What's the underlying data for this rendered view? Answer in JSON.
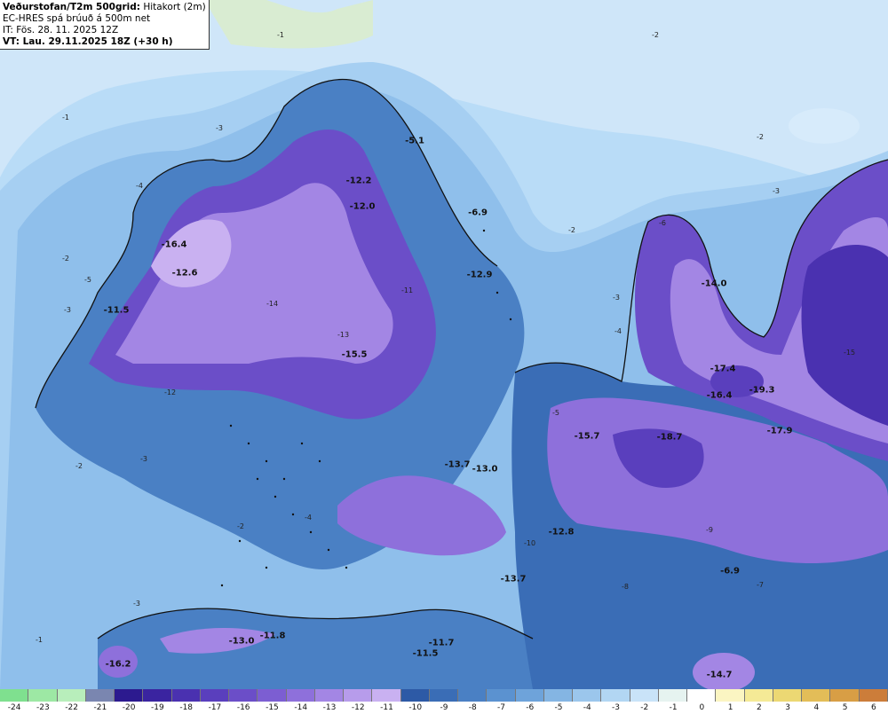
{
  "header": {
    "title_bold": "Veðurstofan/T2m 500grid:",
    "title_rest": " Hitakort (2m)",
    "line2": "EC-HRES spá brúuð á 500m net",
    "line3": "IT: Fös. 28. 11. 2025 12Z",
    "line4": "VT: Lau. 29.11.2025 18Z (+30 h)"
  },
  "map_labels": [
    {
      "text": "-12.2"
    },
    {
      "text": "-12.0"
    },
    {
      "text": "-16.4"
    },
    {
      "text": "-12.6"
    },
    {
      "text": "-11.5"
    },
    {
      "text": "-15.5"
    },
    {
      "text": "-12.9"
    },
    {
      "text": "-14.0"
    },
    {
      "text": "-17.4"
    },
    {
      "text": "-16.4"
    },
    {
      "text": "-19.3"
    },
    {
      "text": "-17.9"
    },
    {
      "text": "-15.7"
    },
    {
      "text": "-18.7"
    },
    {
      "text": "-13.7"
    },
    {
      "text": "-13.0"
    },
    {
      "text": "-12.8"
    },
    {
      "text": "-13.7"
    },
    {
      "text": "-6.9"
    },
    {
      "text": "-13.0"
    },
    {
      "text": "-11.8"
    },
    {
      "text": "-11.7"
    },
    {
      "text": "-11.5"
    },
    {
      "text": "-16.2"
    },
    {
      "text": "-14.7"
    },
    {
      "text": "-5.1"
    },
    {
      "text": "-6.9"
    }
  ],
  "contour_labels": [
    "-1",
    "-2",
    "-3",
    "-4",
    "-5",
    "-6",
    "-7",
    "-8",
    "-9",
    "-10",
    "-11",
    "-12",
    "-13",
    "-14",
    "-15"
  ],
  "colorbar": {
    "ticks": [
      "-24",
      "-23",
      "-22",
      "-21",
      "-20",
      "-19",
      "-18",
      "-17",
      "-16",
      "-15",
      "-14",
      "-13",
      "-12",
      "-11",
      "-10",
      "-9",
      "-8",
      "-7",
      "-6",
      "-5",
      "-4",
      "-3",
      "-2",
      "-1",
      "0",
      "1",
      "2",
      "3",
      "4",
      "5",
      "6"
    ],
    "colors": [
      "#7fe08f",
      "#9de8a4",
      "#b8eebb",
      "#7a86b0",
      "#2c1a8f",
      "#3a24a0",
      "#4a31b0",
      "#5a3fbd",
      "#6b4ec8",
      "#7c5ed2",
      "#8e70db",
      "#a386e4",
      "#b79ceb",
      "#c9b1f1",
      "#2d5aa6",
      "#3a6db6",
      "#4a80c4",
      "#5b92d0",
      "#6ea3da",
      "#84b5e3",
      "#9bc6ec",
      "#b2d6f3",
      "#c9e3f8",
      "#e6f3f0",
      "#ffffff",
      "#fbf5c2",
      "#f5ea96",
      "#ecd873",
      "#e3bd58",
      "#d89e45",
      "#cc7d3a"
    ]
  },
  "colors": {
    "sea": "#b9dcf7",
    "land_low": "#4a80c4",
    "land_mid": "#6b4ec8",
    "land_high": "#c9b1f1",
    "greenland": "#d9ecd2",
    "coast": "#111111"
  }
}
